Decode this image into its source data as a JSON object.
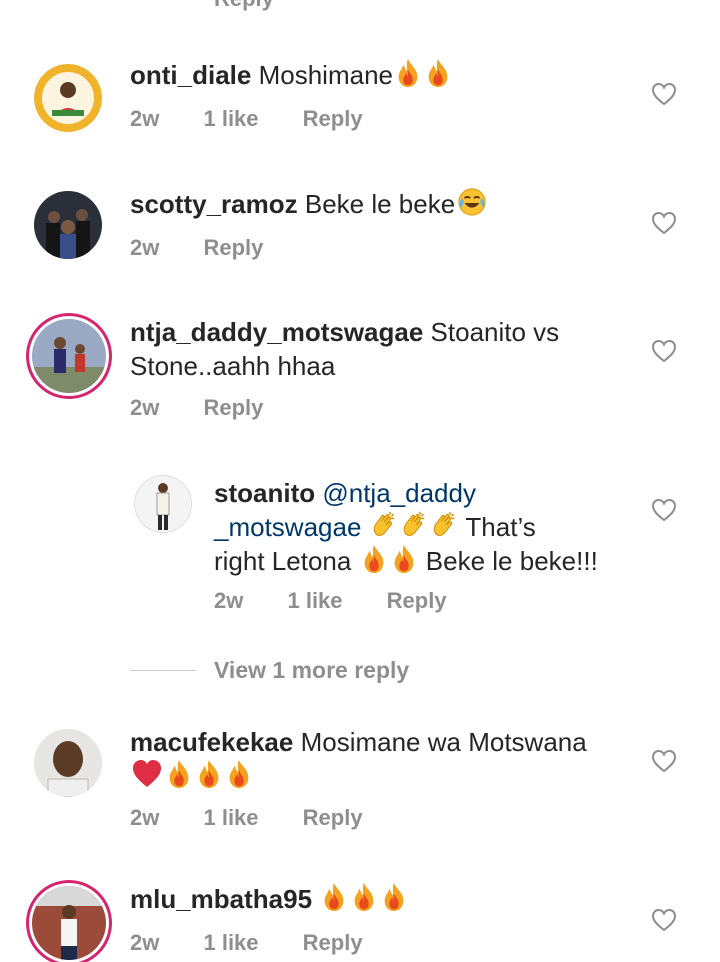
{
  "top_fragment": "Reply",
  "comments": [
    {
      "username": "onti_diale",
      "text": "Moshimane",
      "emoji_after": [
        "fire-emoji",
        "fire-emoji"
      ],
      "age": "2w",
      "likes": "1 like",
      "reply_label": "Reply"
    },
    {
      "username": "scotty_ramoz",
      "text": "Beke le beke",
      "emoji_after": [
        "joy-emoji"
      ],
      "age": "2w",
      "reply_label": "Reply"
    },
    {
      "username": "ntja_daddy_motswagae",
      "text_line1": "Stoanito vs",
      "text_line2": "Stone..aahh hhaa",
      "age": "2w",
      "reply_label": "Reply"
    },
    {
      "username": "stoanito",
      "mention_part1": "@ntja_daddy",
      "mention_part2": "_motswagae",
      "text_a": "That’s",
      "text_b": "right Letona",
      "text_c": "Beke le beke!!!",
      "age": "2w",
      "likes": "1 like",
      "reply_label": "Reply"
    },
    {
      "username": "macufekekae",
      "text": "Mosimane wa Motswana",
      "age": "2w",
      "likes": "1 like",
      "reply_label": "Reply"
    },
    {
      "username": "mlu_mbatha95",
      "age": "2w",
      "likes": "1 like",
      "reply_label": "Reply"
    }
  ],
  "view_more_replies": "View 1 more reply",
  "colors": {
    "story_ring": "#d6246e",
    "meta_gray": "#8e8e8e",
    "mention_blue": "#00376b",
    "fire": "#f47a20"
  }
}
